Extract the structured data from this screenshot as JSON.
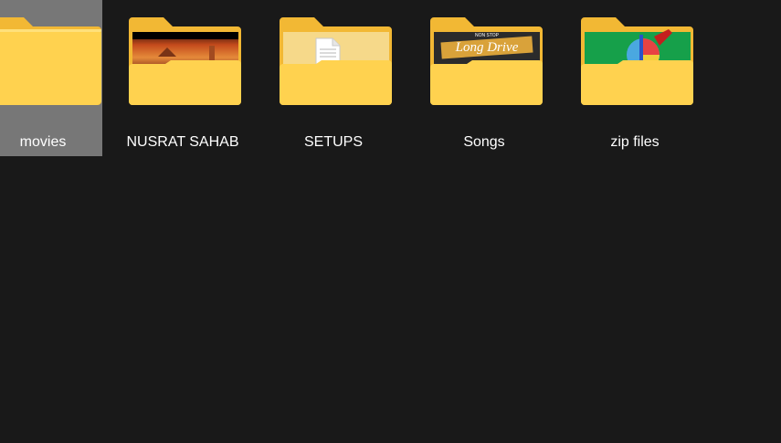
{
  "colors": {
    "background": "#191919",
    "selected_tile": "#777777",
    "folder_back": "#f2b834",
    "folder_front": "#ffd24f",
    "label_text": "#ffffff"
  },
  "folders": [
    {
      "label": "movies",
      "icon": "folder-icon",
      "preview": "none",
      "selected": true
    },
    {
      "label": "NUSRAT SAHAB",
      "icon": "folder-image-icon",
      "preview": "sunset-photo",
      "selected": false
    },
    {
      "label": "SETUPS",
      "icon": "folder-document-icon",
      "preview": "document",
      "selected": false
    },
    {
      "label": "Songs",
      "icon": "folder-image-icon",
      "preview": "long-drive-banner",
      "selected": false
    },
    {
      "label": "zip files",
      "icon": "folder-archive-icon",
      "preview": "archive-app-icon",
      "selected": false
    }
  ],
  "previews": {
    "songs_banner_small": "NON STOP",
    "songs_banner_title": "Long Drive"
  }
}
